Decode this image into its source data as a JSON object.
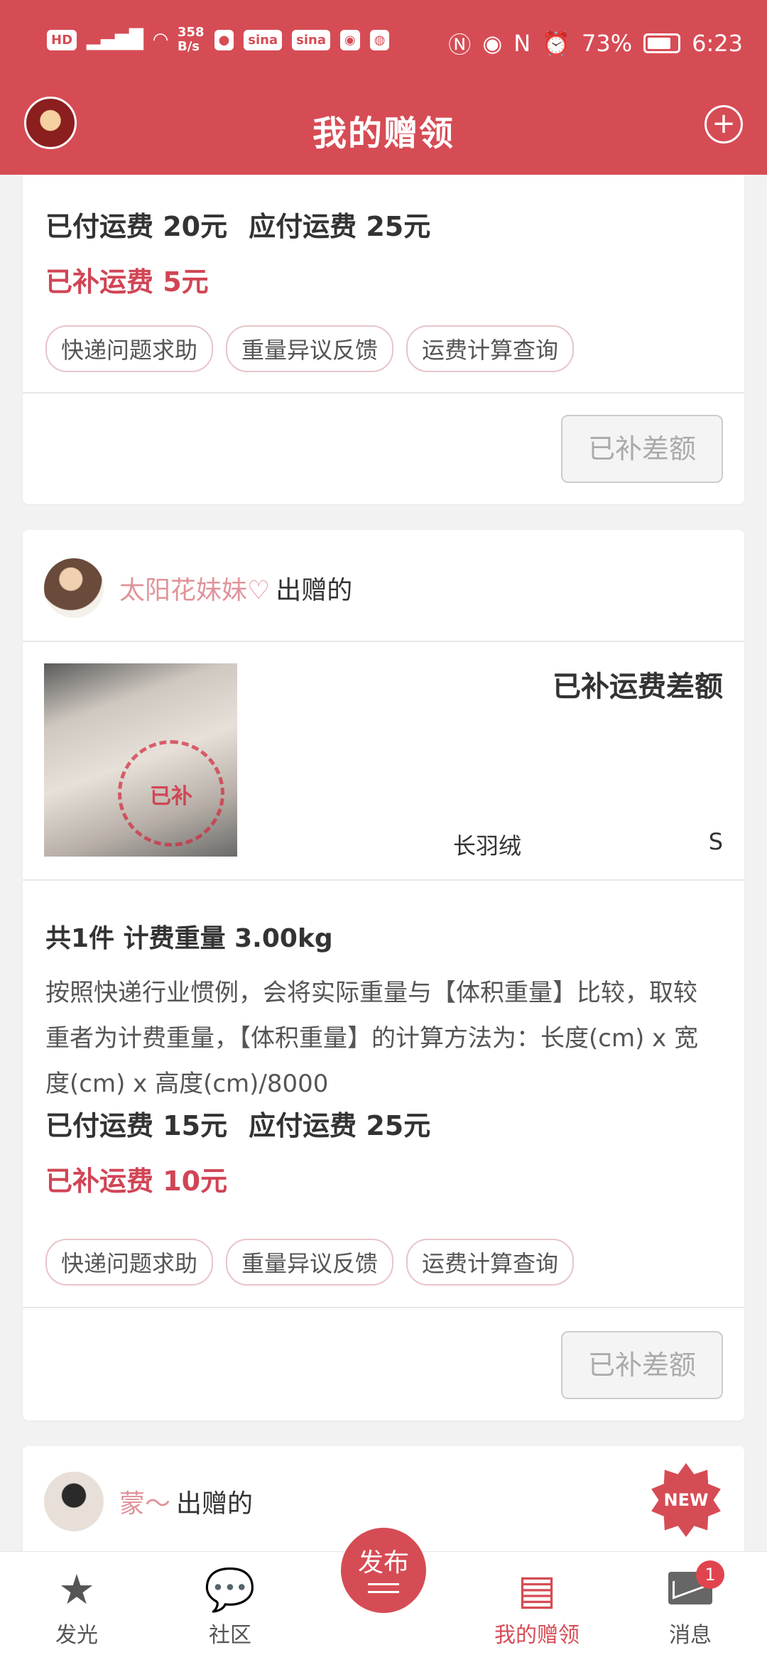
{
  "status_bar": {
    "network": "HD 4G",
    "speed": "358\nB/s",
    "battery": "73%",
    "time": "6:23"
  },
  "header": {
    "title": "我的赠领",
    "add_icon": "plus-circle-icon"
  },
  "card1": {
    "paid_fee": "已付运费 20元",
    "due_fee": "应付运费 25元",
    "supplemented": "已补运费 5元",
    "tags": [
      "快递问题求助",
      "重量异议反馈",
      "运费计算查询"
    ],
    "action": "已补差额"
  },
  "card2": {
    "user_name": "太阳花妹妹♡",
    "user_suffix": "出赠的",
    "status": "已补运费差额",
    "item_name": "长羽绒",
    "item_size": "S",
    "stamp_text": "已补",
    "weight_line": "共1件 计费重量 3.00kg",
    "description": "按照快递行业惯例，会将实际重量与【体积重量】比较，取较重者为计费重量，【体积重量】的计算方法为：长度(cm) x 宽度(cm) x 高度(cm)/8000",
    "paid_fee": "已付运费 15元",
    "due_fee": "应付运费 25元",
    "supplemented": "已补运费 10元",
    "tags": [
      "快递问题求助",
      "重量异议反馈",
      "运费计算查询"
    ],
    "action": "已补差额"
  },
  "card3": {
    "user_name": "蒙～",
    "user_suffix": "出赠的",
    "badge": "NEW"
  },
  "bottom_nav": {
    "items": [
      {
        "label": "发光",
        "icon": "star-icon"
      },
      {
        "label": "社区",
        "icon": "chat-bubbles-icon"
      },
      {
        "label": "发布",
        "icon": "publish-icon"
      },
      {
        "label": "我的赠领",
        "icon": "gift-box-icon"
      },
      {
        "label": "消息",
        "icon": "mail-icon"
      }
    ],
    "message_badge": "1"
  },
  "colors": {
    "brand": "#d64c55",
    "accent_red": "#d04555"
  }
}
